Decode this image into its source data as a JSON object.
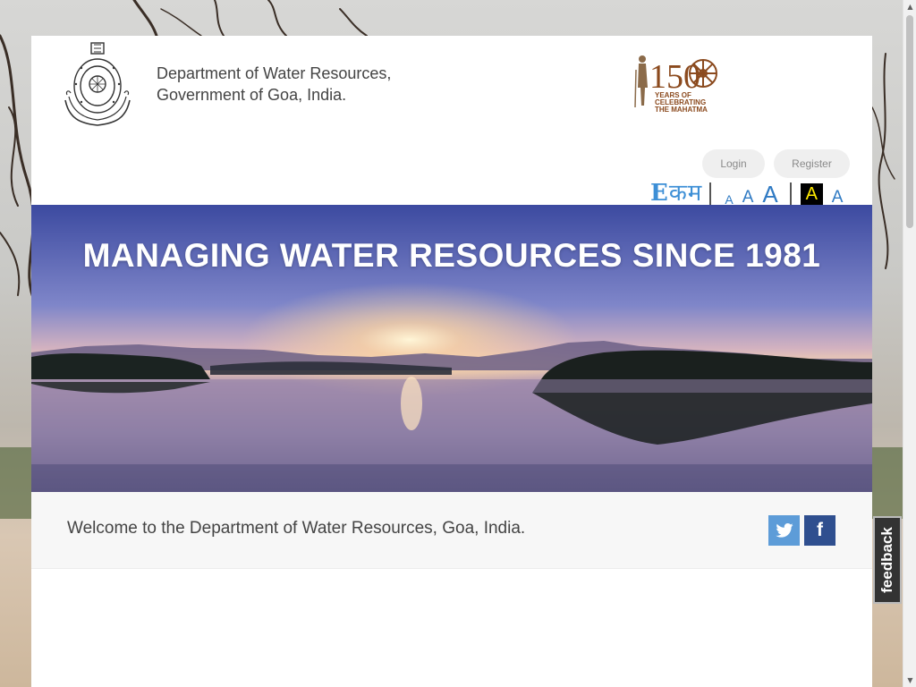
{
  "header": {
    "dept_line1": "Department of Water Resources,",
    "dept_line2": "Government of Goa, India.",
    "emblem_icon": "goa-government-emblem",
    "logo_150": {
      "number": "150",
      "line1": "YEARS OF",
      "line2": "CELEBRATING",
      "line3": "THE MAHATMA"
    }
  },
  "auth": {
    "login_label": "Login",
    "register_label": "Register"
  },
  "accessibility": {
    "language_switch": "Eकम",
    "font_small": "A",
    "font_medium": "A",
    "font_large": "A",
    "contrast_dark": "A",
    "contrast_normal": "A"
  },
  "banner": {
    "title": "MANAGING WATER RESOURCES SINCE 1981"
  },
  "welcome": {
    "text": "Welcome to the Department of Water Resources, Goa, India."
  },
  "social": {
    "twitter_icon": "twitter-icon",
    "facebook_label": "f"
  },
  "feedback": {
    "label": "feedback"
  },
  "colors": {
    "link_blue": "#2f7ac3",
    "twitter": "#5d9cd8",
    "facebook": "#2f4f8f",
    "logo_brown": "#8b4a1e"
  }
}
